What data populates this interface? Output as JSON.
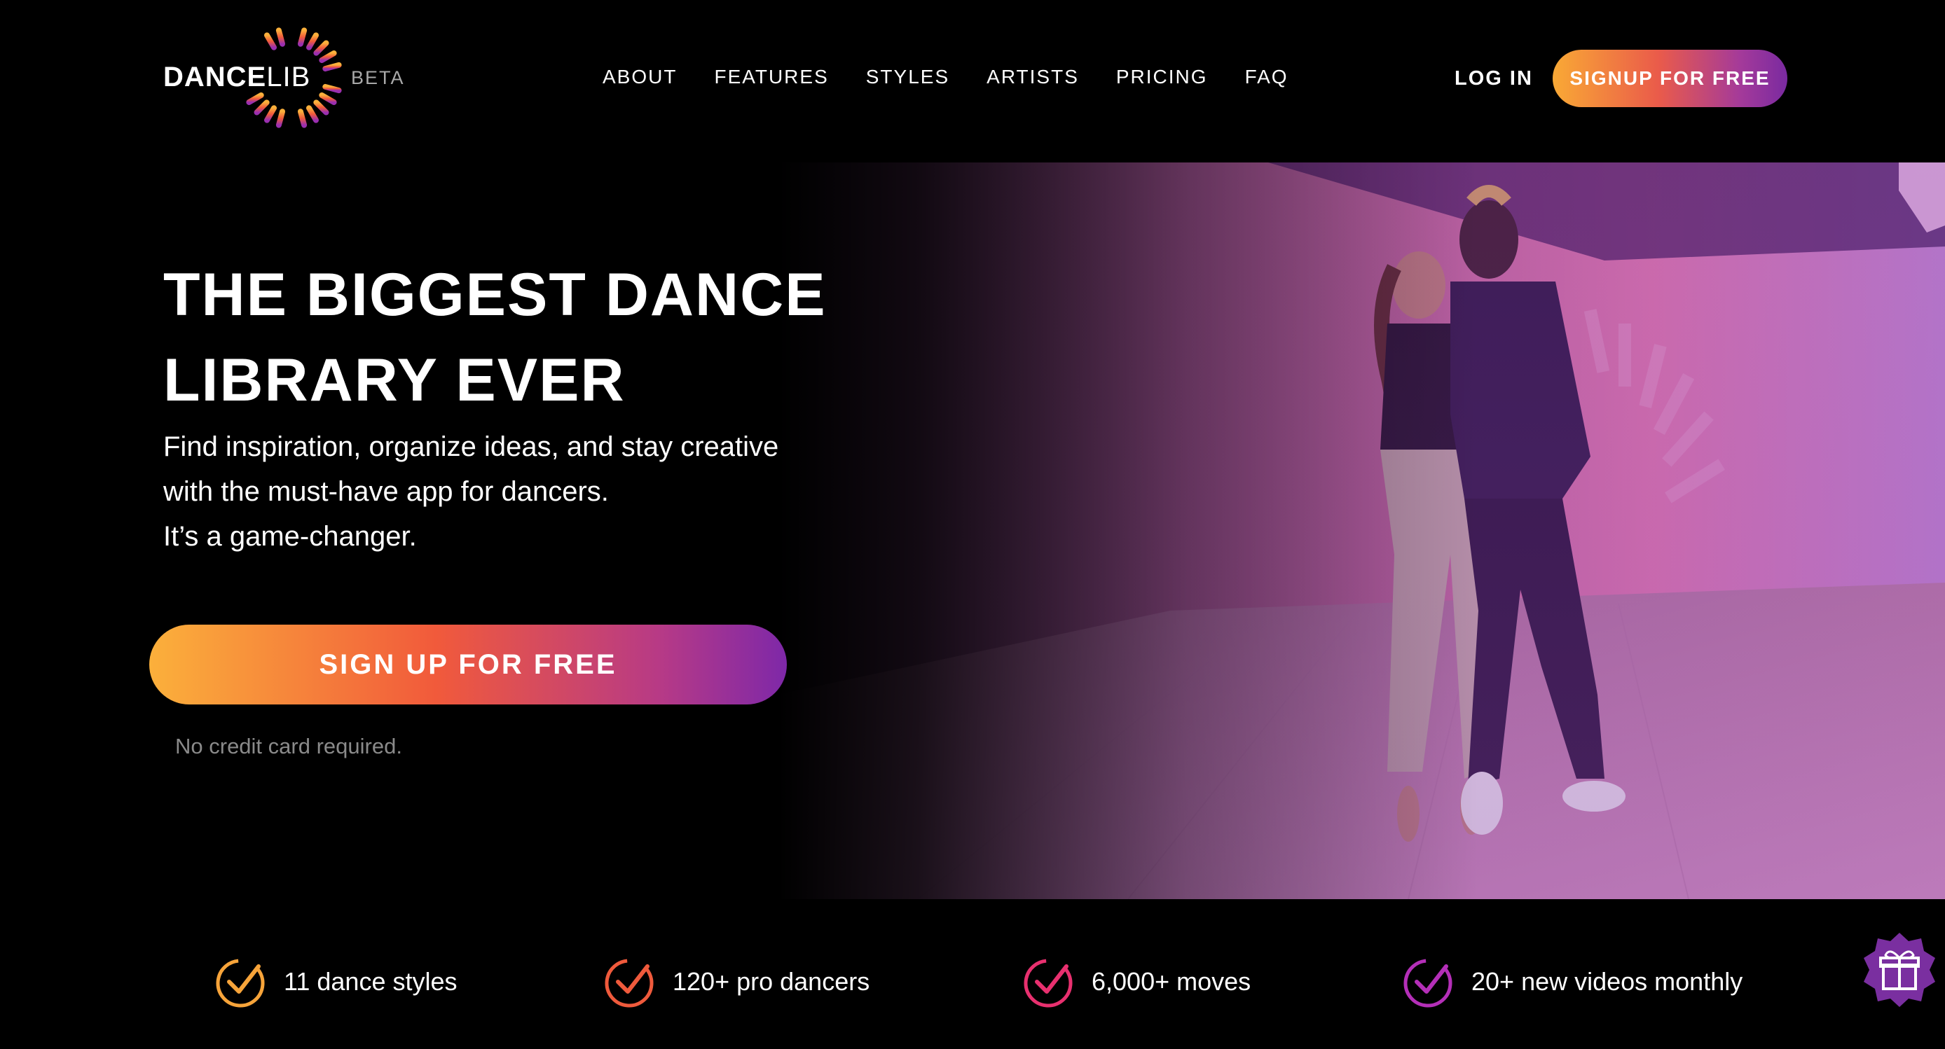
{
  "header": {
    "logo": {
      "dance": "DANCE",
      "lib": "LIB",
      "badge": "BETA"
    },
    "nav": [
      {
        "label": "ABOUT"
      },
      {
        "label": "FEATURES"
      },
      {
        "label": "STYLES"
      },
      {
        "label": "ARTISTS"
      },
      {
        "label": "PRICING"
      },
      {
        "label": "FAQ"
      }
    ],
    "login_label": "LOG IN",
    "signup_label": "SIGNUP FOR FREE"
  },
  "hero": {
    "headline": "THE BIGGEST DANCE LIBRARY EVER",
    "subtext": [
      "Find inspiration, organize ideas, and stay creative",
      "with the must-have app for dancers.",
      "It’s a game-changer."
    ],
    "cta_label": "SIGN UP FOR FREE",
    "cta_note": "No credit card required."
  },
  "features": [
    {
      "label": "11 dance styles",
      "color": "#f7a43a",
      "icon": "check-circle-icon"
    },
    {
      "label": "120+ pro dancers",
      "color": "#ef5a3c",
      "icon": "check-circle-icon"
    },
    {
      "label": "6,000+ moves",
      "color": "#e8306f",
      "icon": "check-circle-icon"
    },
    {
      "label": "20+ new videos monthly",
      "color": "#b42fb8",
      "icon": "check-circle-icon"
    }
  ],
  "gift_icon": "gift-icon",
  "colors": {
    "background": "#000000",
    "gradient_start": "#fbb03b",
    "gradient_mid": "#f15a3b",
    "gradient_end": "#7e28a8"
  }
}
